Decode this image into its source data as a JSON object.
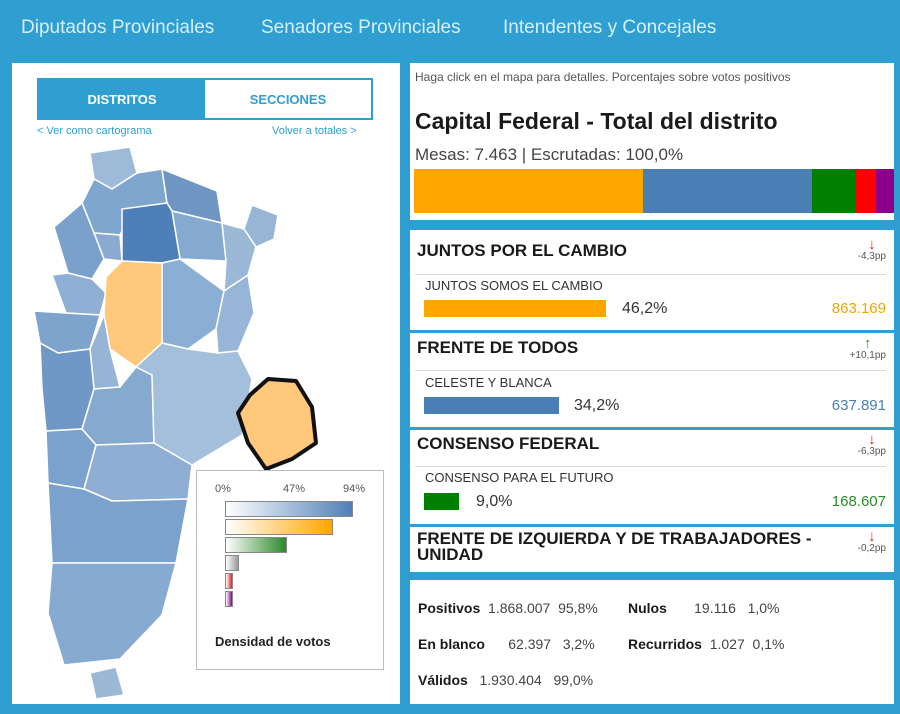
{
  "nav": {
    "tabs": [
      "Diputados Provinciales",
      "Senadores Provinciales",
      "Intendentes y Concejales"
    ]
  },
  "map_panel": {
    "toggle_distritos": "DISTRITOS",
    "toggle_secciones": "SECCIONES",
    "link_cartograma": "< Ver como cartograma",
    "link_totales": "Volver a totales >",
    "legend": {
      "ticks": [
        "0%",
        "47%",
        "94%"
      ],
      "title": "Densidad de votos"
    }
  },
  "header": {
    "hint": "Haga click en el mapa para detalles. Porcentajes sobre votos positivos",
    "title": "Capital Federal - Total del distrito",
    "subtitle": "Mesas: 7.463 | Escrutadas: 100,0%",
    "stack": [
      {
        "color": "#ffa500",
        "share": 46.2
      },
      {
        "color": "#4a7fb5",
        "share": 34.2
      },
      {
        "color": "#008000",
        "share": 9.0
      },
      {
        "color": "#ff0000",
        "share": 4.0
      },
      {
        "color": "#8b008b",
        "share": 3.6
      }
    ]
  },
  "parties": [
    {
      "name": "JUNTOS POR EL CAMBIO",
      "change": "-4,3pp",
      "direction": "down",
      "list": "JUNTOS SOMOS EL CAMBIO",
      "pct": "46,2%",
      "share": 46.2,
      "votes": "863.169",
      "color": "#ffa500",
      "votes_color": "#f0a500"
    },
    {
      "name": "FRENTE DE TODOS",
      "change": "+10,1pp",
      "direction": "up",
      "list": "CELESTE Y BLANCA",
      "pct": "34,2%",
      "share": 34.2,
      "votes": "637.891",
      "color": "#4a7fb5",
      "votes_color": "#4a7fb5"
    },
    {
      "name": "CONSENSO FEDERAL",
      "change": "-6,3pp",
      "direction": "down",
      "list": "CONSENSO PARA EL FUTURO",
      "pct": "9,0%",
      "share": 9.0,
      "votes": "168.607",
      "color": "#008000",
      "votes_color": "#2a8a2a"
    },
    {
      "name": "FRENTE DE IZQUIERDA Y DE TRABAJADORES - UNIDAD",
      "change": "-0,2pp",
      "direction": "down"
    }
  ],
  "totals": {
    "positivos": {
      "label": "Positivos",
      "votes": "1.868.007",
      "pct": "95,8%"
    },
    "nulos": {
      "label": "Nulos",
      "votes": "19.116",
      "pct": "1,0%"
    },
    "blanco": {
      "label": "En blanco",
      "votes": "62.397",
      "pct": "3,2%"
    },
    "recurridos": {
      "label": "Recurridos",
      "votes": "1.027",
      "pct": "0,1%"
    },
    "validos": {
      "label": "Válidos",
      "votes": "1.930.404",
      "pct": "99,0%"
    }
  },
  "colors": {
    "accent": "#2e9fd0",
    "down_arrow": "#e02020",
    "up_arrow": "#2a9a2a"
  }
}
